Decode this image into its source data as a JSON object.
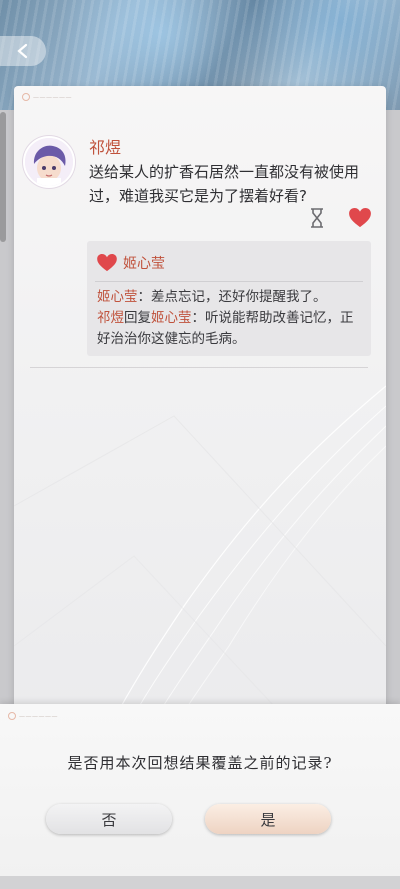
{
  "navigation": {
    "back_icon": "chevron-left-icon"
  },
  "post": {
    "author": "祁煜",
    "text": "送给某人的扩香石居然一直都没有被使用过，难道我买它是为了摆着好看?",
    "icons": [
      "hourglass-icon",
      "heart-icon"
    ]
  },
  "reply": {
    "header_name": "姬心莹",
    "line1_name": "姬心莹",
    "line1_text": "：差点忘记，还好你提醒我了。",
    "line2_name": "祁煜",
    "line2_mid": "回复",
    "line2_target": "姬心莹",
    "line2_text": "：听说能帮助改善记忆，正好治治你这健忘的毛病。"
  },
  "dialog": {
    "question": "是否用本次回想结果覆盖之前的记录?",
    "no_label": "否",
    "yes_label": "是"
  },
  "colors": {
    "accent": "#c0523c",
    "heart": "#e0484c"
  }
}
